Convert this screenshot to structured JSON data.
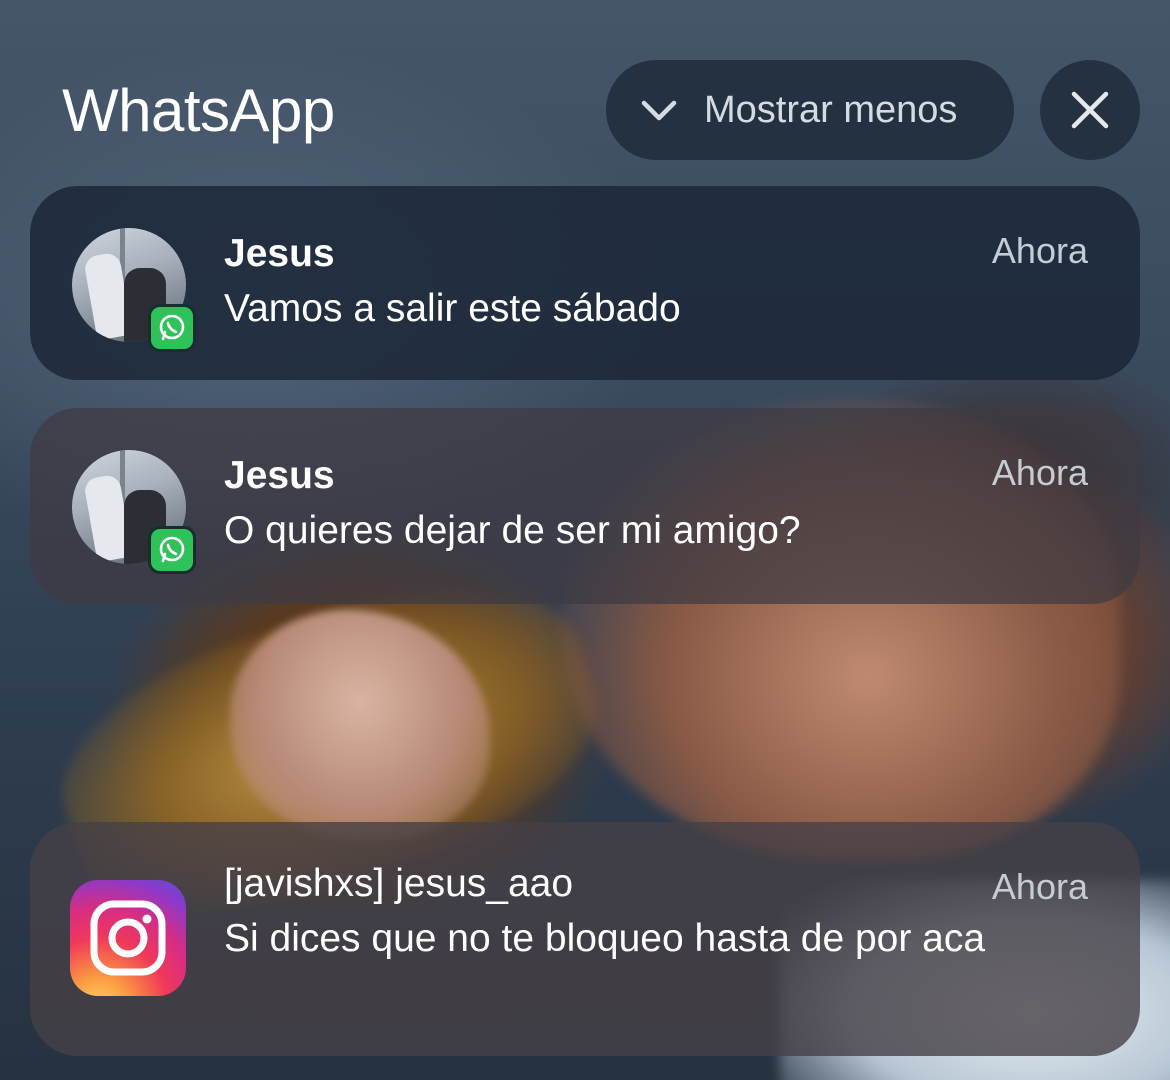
{
  "header": {
    "app_name": "WhatsApp",
    "show_less_label": "Mostrar menos"
  },
  "notifications": [
    {
      "app": "WhatsApp",
      "sender": "Jesus",
      "message": "Vamos a salir este sábado",
      "time": "Ahora",
      "icon": "contact-avatar-with-whatsapp-badge"
    },
    {
      "app": "WhatsApp",
      "sender": "Jesus",
      "message": "O quieres dejar de ser mi amigo?",
      "time": "Ahora",
      "icon": "contact-avatar-with-whatsapp-badge"
    },
    {
      "app": "Instagram",
      "sender": "[javishxs] jesus_aao",
      "message": "Si dices que no te bloqueo hasta de por aca",
      "time": "Ahora",
      "icon": "instagram-icon"
    }
  ],
  "colors": {
    "whatsapp_green": "#2fc15a",
    "text_primary": "#ffffff",
    "text_secondary": "#c5ccd4"
  }
}
